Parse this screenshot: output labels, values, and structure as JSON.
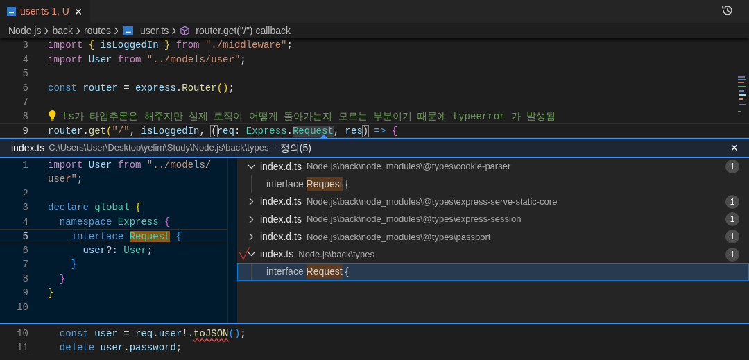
{
  "tab": {
    "title": "user.ts",
    "status": "1, U",
    "close": "×"
  },
  "breadcrumbs": [
    {
      "kind": "folder",
      "label": "Node.js"
    },
    {
      "kind": "folder",
      "label": "back"
    },
    {
      "kind": "folder",
      "label": "routes"
    },
    {
      "kind": "file",
      "label": "user.ts"
    },
    {
      "kind": "symbol",
      "label": "router.get(\"/\") callback"
    }
  ],
  "editor_top": {
    "lines": [
      {
        "number": "3",
        "current": false,
        "segments": [
          {
            "text": "import",
            "color": "#c586c0"
          },
          {
            "text": " {",
            "color": "#ffd700"
          },
          {
            "text": " isLoggedIn ",
            "color": "#9cdcfe"
          },
          {
            "text": "}",
            "color": "#ffd700"
          },
          {
            "text": " from",
            "color": "#c586c0"
          },
          {
            "text": " \"./middleware\"",
            "color": "#ce9178"
          },
          {
            "text": ";"
          }
        ]
      },
      {
        "number": "4",
        "current": false,
        "segments": [
          {
            "text": "import",
            "color": "#c586c0"
          },
          {
            "text": " User",
            "color": "#9cdcfe"
          },
          {
            "text": " from",
            "color": "#c586c0"
          },
          {
            "text": " \"../models/user\"",
            "color": "#ce9178"
          },
          {
            "text": ";"
          }
        ]
      },
      {
        "number": "5",
        "current": false
      },
      {
        "number": "6",
        "current": false,
        "segments": [
          {
            "text": "const",
            "color": "#569cd6"
          },
          {
            "text": " router",
            "color": "#9cdcfe"
          },
          {
            "text": " = "
          },
          {
            "text": "express",
            "color": "#9cdcfe"
          },
          {
            "text": "."
          },
          {
            "text": "Router",
            "color": "#dcdcaa"
          },
          {
            "text": "()",
            "color": "#ffd700"
          },
          {
            "text": ";"
          }
        ]
      },
      {
        "number": "7",
        "current": false
      },
      {
        "number": "8",
        "current": false,
        "lightbulb": true,
        "segments": [
          {
            "text": "ts가 타입추론은 해주지만 실제 로직이 어떻게 돌아가는지 모르는 부분이기 때문에 typeerror 가 발생됨",
            "color": "#6a9955"
          }
        ]
      },
      {
        "number": "9",
        "current": true,
        "segments": [
          {
            "text": "router",
            "color": "#9cdcfe"
          },
          {
            "text": "."
          },
          {
            "text": "get",
            "color": "#dcdcaa"
          },
          {
            "text": "(",
            "color": "#ffd700"
          },
          {
            "text": "\"/\"",
            "color": "#ce9178"
          },
          {
            "text": ", "
          },
          {
            "text": "isLoggedIn",
            "color": "#9cdcfe"
          },
          {
            "text": ", "
          },
          {
            "text": "(",
            "kind": "bracket"
          },
          {
            "text": "req",
            "color": "#9cdcfe"
          },
          {
            "text": ": "
          },
          {
            "text": "Express",
            "color": "#4ec9b0"
          },
          {
            "text": "."
          },
          {
            "text": "Request",
            "kind": "selection"
          },
          {
            "text": ", "
          },
          {
            "text": "res",
            "color": "#9cdcfe"
          },
          {
            "text": ")",
            "kind": "bracket"
          },
          {
            "text": " =>",
            "color": "#569cd6"
          },
          {
            "text": " {",
            "color": "#da70d6"
          }
        ]
      }
    ]
  },
  "peek": {
    "file": "index.ts",
    "path": "C:\\Users\\User\\Desktop\\yelim\\Study\\Node.js\\back\\types",
    "separator": "-",
    "title": "정의(5)",
    "close": "×",
    "lines": [
      {
        "number": "1",
        "current": false,
        "segments": [
          {
            "text": "import",
            "color": "#c586c0"
          },
          {
            "text": " User",
            "color": "#9cdcfe"
          },
          {
            "text": " from",
            "color": "#c586c0"
          },
          {
            "text": " \"../models/",
            "color": "#ce9178"
          },
          {
            "text": "user\"",
            "color": "#ce9178",
            "wrap": true
          },
          {
            "text": ";"
          }
        ]
      },
      {
        "number": "2",
        "current": false
      },
      {
        "number": "3",
        "current": false,
        "segments": [
          {
            "text": "declare",
            "color": "#569cd6"
          },
          {
            "text": " global",
            "color": "#4ec9b0"
          },
          {
            "text": " {",
            "color": "#ffd700"
          }
        ]
      },
      {
        "number": "4",
        "current": false,
        "segments": [
          {
            "text": "  namespace",
            "color": "#569cd6"
          },
          {
            "text": " Express",
            "color": "#4ec9b0"
          },
          {
            "text": " {",
            "color": "#da70d6"
          }
        ]
      },
      {
        "number": "5",
        "current": true,
        "segments": [
          {
            "text": "    interface ",
            "color": "#569cd6"
          },
          {
            "text": "Request",
            "kind": "match"
          },
          {
            "text": " {",
            "color": "#179fff"
          }
        ]
      },
      {
        "number": "6",
        "current": false,
        "segments": [
          {
            "text": "      user",
            "color": "#9cdcfe"
          },
          {
            "text": "?: "
          },
          {
            "text": "User",
            "color": "#4ec9b0"
          },
          {
            "text": ";"
          }
        ]
      },
      {
        "number": "7",
        "current": false,
        "segments": [
          {
            "text": "    }",
            "color": "#179fff"
          }
        ]
      },
      {
        "number": "8",
        "current": false,
        "segments": [
          {
            "text": "  }",
            "color": "#da70d6"
          }
        ]
      },
      {
        "number": "9",
        "current": false,
        "segments": [
          {
            "text": "}",
            "color": "#ffd700"
          }
        ]
      },
      {
        "number": "10",
        "current": false
      }
    ],
    "references": [
      {
        "file": "index.d.ts",
        "path": "Node.js\\back\\node_modules\\@types\\cookie-parser",
        "count": "1",
        "expanded": true,
        "matches": [
          {
            "before": "interface",
            "match": "Request",
            "after": "{",
            "selected": false
          }
        ]
      },
      {
        "file": "index.d.ts",
        "path": "Node.js\\back\\node_modules\\@types\\express-serve-static-core",
        "count": "1",
        "expanded": false
      },
      {
        "file": "index.d.ts",
        "path": "Node.js\\back\\node_modules\\@types\\express-session",
        "count": "1",
        "expanded": false
      },
      {
        "file": "index.d.ts",
        "path": "Node.js\\back\\node_modules\\@types\\passport",
        "count": "1",
        "expanded": false
      },
      {
        "file": "index.ts",
        "path": "Node.js\\back\\types",
        "count": "1",
        "expanded": true,
        "matches": [
          {
            "before": "interface",
            "match": "Request",
            "after": "{",
            "selected": true
          }
        ]
      }
    ]
  },
  "editor_bottom": {
    "lines": [
      {
        "number": "10",
        "current": false,
        "segments": [
          {
            "text": "  const",
            "color": "#569cd6"
          },
          {
            "text": " user",
            "color": "#9cdcfe"
          },
          {
            "text": " = "
          },
          {
            "text": "req",
            "color": "#9cdcfe"
          },
          {
            "text": "."
          },
          {
            "text": "user",
            "color": "#9cdcfe"
          },
          {
            "text": "!."
          },
          {
            "text": "toJSON",
            "color": "#dcdcaa",
            "kind": "error"
          },
          {
            "text": "()",
            "color": "#179fff"
          },
          {
            "text": ";"
          }
        ]
      },
      {
        "number": "11",
        "current": false,
        "segments": [
          {
            "text": "  delete",
            "color": "#569cd6"
          },
          {
            "text": " user",
            "color": "#9cdcfe"
          },
          {
            "text": "."
          },
          {
            "text": "password",
            "color": "#9cdcfe"
          },
          {
            "text": ";"
          }
        ]
      }
    ]
  }
}
